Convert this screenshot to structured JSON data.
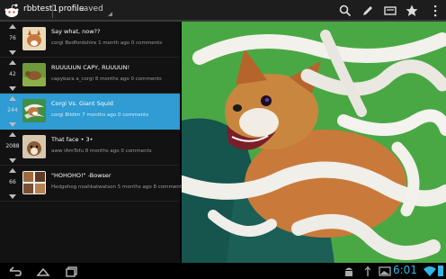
{
  "header": {
    "username": "rbbtest1",
    "tabs": [
      {
        "label": "profile"
      },
      {
        "label": "saved"
      }
    ],
    "actions": [
      "search-icon",
      "pencil-icon",
      "card-icon",
      "star-icon",
      "overflow-icon"
    ]
  },
  "posts": [
    {
      "score": "76",
      "title": "Say what, now??",
      "meta": "corgi  Bedfordshire  1 month ago  0 comments",
      "thumb": "corgi-photo",
      "selected": false
    },
    {
      "score": "42",
      "title": "RUUUUUN CAPY, RUUUUN!",
      "meta": "capybara  a_corgi  8 months ago  0 comments",
      "thumb": "capybara-photo",
      "selected": false
    },
    {
      "score": "244",
      "title": "Corgi Vs. Giant Squid",
      "meta": "corgi  Bildim  7 months ago  0 comments",
      "thumb": "corgi-squid-photo",
      "selected": true
    },
    {
      "score": "2088",
      "title": "That face • 3•",
      "meta": "aww  iAmTofu  8 months ago  0 comments",
      "thumb": "face-photo",
      "selected": false
    },
    {
      "score": "66",
      "title": "\"HOHOHO!\" -Bowser",
      "meta": "Hedgehog  noahkatwatson  5 months ago  8 comments",
      "thumb": "hedgehog-photo",
      "selected": false
    }
  ],
  "preview": {
    "subject": "corgi tangled in white plush tentacles"
  },
  "statusbar": {
    "time": "6:01",
    "icons": [
      "back-icon",
      "home-icon",
      "recents-icon",
      "android-icon",
      "usb-icon",
      "gallery-icon",
      "wifi-icon",
      "battery-icon"
    ],
    "accent": "#33b5e5"
  },
  "colors": {
    "selected_row": "#2f9cd3",
    "actionbar": "#1d1d1d",
    "list_bg": "#121212"
  }
}
